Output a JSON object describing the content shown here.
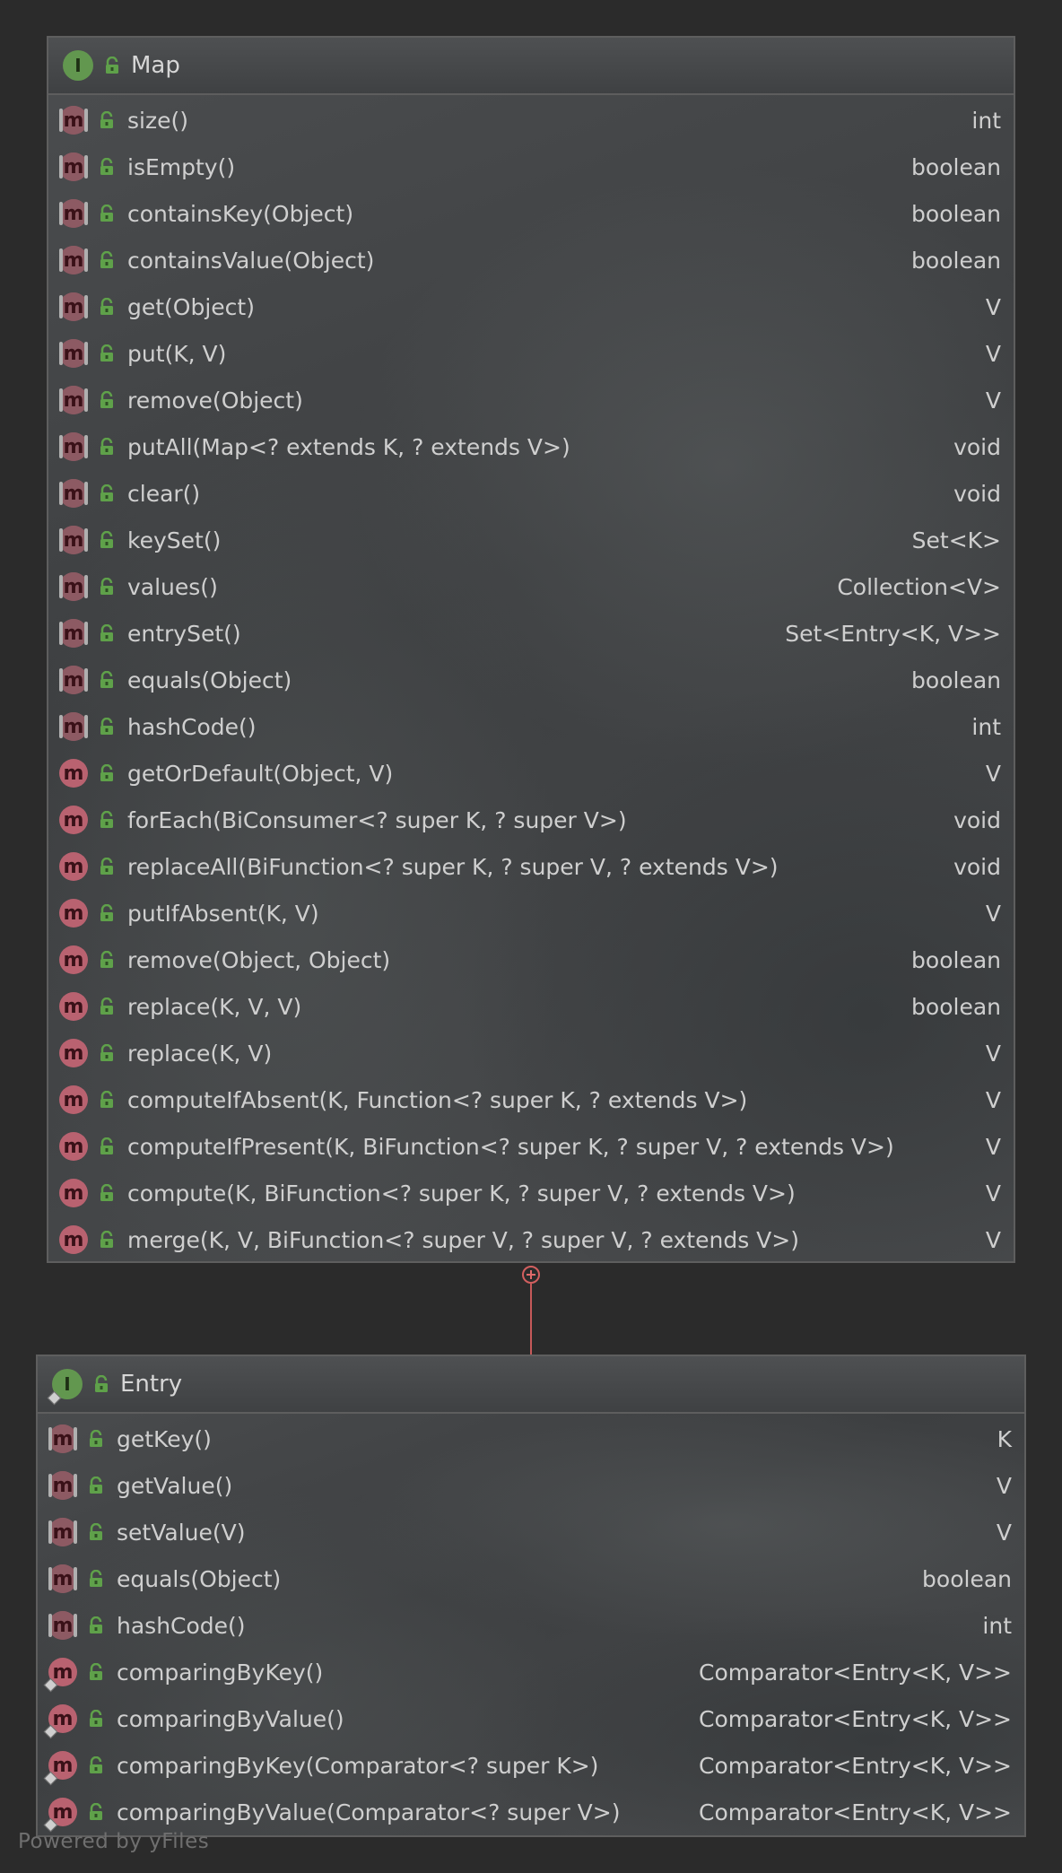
{
  "map": {
    "name": "Map",
    "methods": [
      {
        "sig": "size()",
        "ret": "int",
        "kind": "abstract"
      },
      {
        "sig": "isEmpty()",
        "ret": "boolean",
        "kind": "abstract"
      },
      {
        "sig": "containsKey(Object)",
        "ret": "boolean",
        "kind": "abstract"
      },
      {
        "sig": "containsValue(Object)",
        "ret": "boolean",
        "kind": "abstract"
      },
      {
        "sig": "get(Object)",
        "ret": "V",
        "kind": "abstract"
      },
      {
        "sig": "put(K, V)",
        "ret": "V",
        "kind": "abstract"
      },
      {
        "sig": "remove(Object)",
        "ret": "V",
        "kind": "abstract"
      },
      {
        "sig": "putAll(Map<? extends K, ? extends V>)",
        "ret": "void",
        "kind": "abstract"
      },
      {
        "sig": "clear()",
        "ret": "void",
        "kind": "abstract"
      },
      {
        "sig": "keySet()",
        "ret": "Set<K>",
        "kind": "abstract"
      },
      {
        "sig": "values()",
        "ret": "Collection<V>",
        "kind": "abstract"
      },
      {
        "sig": "entrySet()",
        "ret": "Set<Entry<K, V>>",
        "kind": "abstract"
      },
      {
        "sig": "equals(Object)",
        "ret": "boolean",
        "kind": "abstract"
      },
      {
        "sig": "hashCode()",
        "ret": "int",
        "kind": "abstract"
      },
      {
        "sig": "getOrDefault(Object, V)",
        "ret": "V",
        "kind": "default"
      },
      {
        "sig": "forEach(BiConsumer<? super K, ? super V>)",
        "ret": "void",
        "kind": "default"
      },
      {
        "sig": "replaceAll(BiFunction<? super K, ? super V, ? extends V>)",
        "ret": "void",
        "kind": "default"
      },
      {
        "sig": "putIfAbsent(K, V)",
        "ret": "V",
        "kind": "default"
      },
      {
        "sig": "remove(Object, Object)",
        "ret": "boolean",
        "kind": "default"
      },
      {
        "sig": "replace(K, V, V)",
        "ret": "boolean",
        "kind": "default"
      },
      {
        "sig": "replace(K, V)",
        "ret": "V",
        "kind": "default"
      },
      {
        "sig": "computeIfAbsent(K, Function<? super K, ? extends V>)",
        "ret": "V",
        "kind": "default"
      },
      {
        "sig": "computeIfPresent(K, BiFunction<? super K, ? super V, ? extends V>)",
        "ret": "V",
        "kind": "default"
      },
      {
        "sig": "compute(K, BiFunction<? super K, ? super V, ? extends V>)",
        "ret": "V",
        "kind": "default"
      },
      {
        "sig": "merge(K, V, BiFunction<? super V, ? super V, ? extends V>)",
        "ret": "V",
        "kind": "default"
      }
    ]
  },
  "entry": {
    "name": "Entry",
    "methods": [
      {
        "sig": "getKey()",
        "ret": "K",
        "kind": "abstract"
      },
      {
        "sig": "getValue()",
        "ret": "V",
        "kind": "abstract"
      },
      {
        "sig": "setValue(V)",
        "ret": "V",
        "kind": "abstract"
      },
      {
        "sig": "equals(Object)",
        "ret": "boolean",
        "kind": "abstract"
      },
      {
        "sig": "hashCode()",
        "ret": "int",
        "kind": "abstract"
      },
      {
        "sig": "comparingByKey()",
        "ret": "Comparator<Entry<K, V>>",
        "kind": "static"
      },
      {
        "sig": "comparingByValue()",
        "ret": "Comparator<Entry<K, V>>",
        "kind": "static"
      },
      {
        "sig": "comparingByKey(Comparator<? super K>)",
        "ret": "Comparator<Entry<K, V>>",
        "kind": "static"
      },
      {
        "sig": "comparingByValue(Comparator<? super V>)",
        "ret": "Comparator<Entry<K, V>>",
        "kind": "static"
      }
    ]
  },
  "icons": {
    "interface_letter": "I",
    "method_letter": "m"
  },
  "colors": {
    "interface_icon": "#62974f",
    "method_icon": "#b96270",
    "public_lock": "#5fa14a",
    "connector": "#c65a5a"
  },
  "footer": "Powered by yFiles"
}
